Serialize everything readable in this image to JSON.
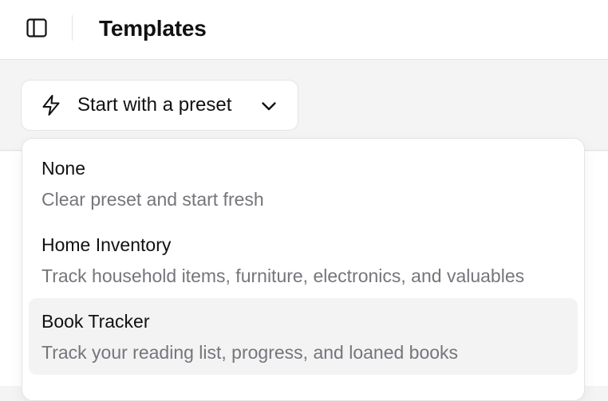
{
  "header": {
    "title": "Templates",
    "sidebar_toggle_icon": "sidebar-panel-icon"
  },
  "preset_select": {
    "label": "Start with a preset",
    "icon": "lightning-bolt-icon",
    "chevron_icon": "chevron-down-icon",
    "expanded": true
  },
  "dropdown": {
    "options": [
      {
        "title": "None",
        "description": "Clear preset and start fresh",
        "highlighted": false
      },
      {
        "title": "Home Inventory",
        "description": "Track household items, furniture, electronics, and valuables",
        "highlighted": false
      },
      {
        "title": "Book Tracker",
        "description": "Track your reading list, progress, and loaned books",
        "highlighted": true
      }
    ]
  },
  "colors": {
    "background": "#f4f4f5",
    "surface": "#ffffff",
    "border": "#e4e4e7",
    "text_primary": "#111111",
    "text_secondary": "#75757b",
    "highlight": "#f3f3f4"
  }
}
